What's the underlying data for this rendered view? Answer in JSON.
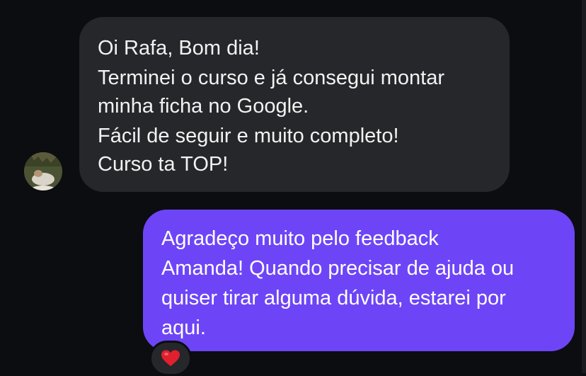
{
  "chat": {
    "incoming": {
      "lines": [
        "Oi Rafa, Bom dia!",
        "Terminei o curso e já consegui montar",
        "minha ficha no Google.",
        "Fácil de seguir e muito completo!",
        "Curso ta TOP!"
      ],
      "avatar_icon": "user-avatar-photo",
      "bubble_color": "#26272b"
    },
    "outgoing": {
      "lines": [
        "Agradeço muito pelo feedback",
        "Amanda! Quando precisar de ajuda ou",
        "quiser tirar alguma dúvida, estarei por",
        "aqui."
      ],
      "bubble_color": "#6d45f7",
      "reaction_icon": "heart-icon"
    }
  },
  "colors": {
    "background": "#0c0d10",
    "heart": "#e0202e"
  }
}
